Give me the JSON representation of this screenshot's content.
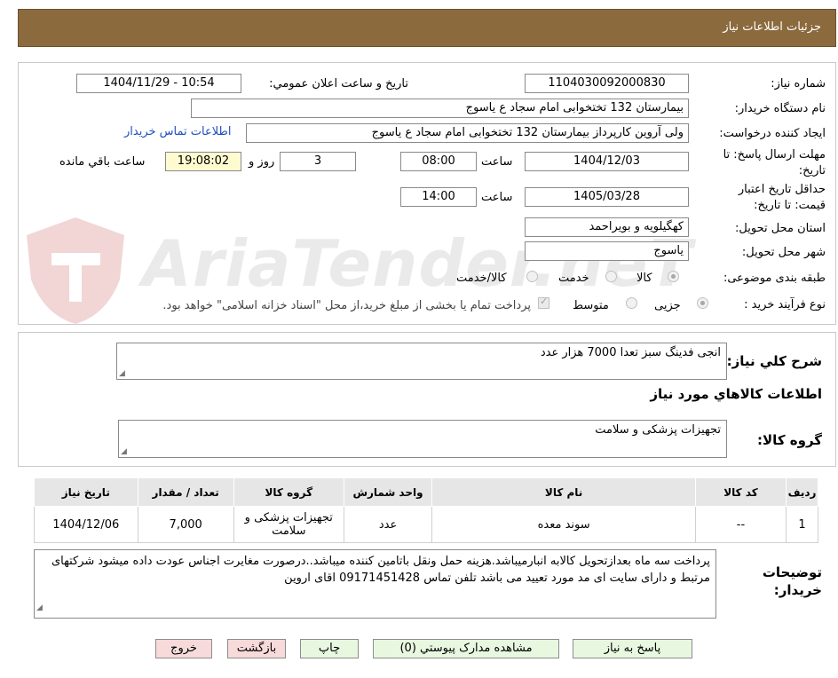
{
  "header": {
    "title": "جزئيات اطلاعات نياز"
  },
  "watermark": {
    "text": "AriaTender.neT"
  },
  "fields": {
    "need_number_label": "شماره نياز:",
    "need_number": "1104030092000830",
    "announce_label": "تاريخ و ساعت اعلان عمومي:",
    "announce_value": "1404/11/29 - 10:54",
    "buyer_org_label": "نام دستگاه خريدار:",
    "buyer_org": "بیمارستان 132 تختخوابی امام سجاد  ع  یاسوج",
    "requester_label": "ايجاد کننده درخواست:",
    "requester": "ولی آروین کارپرداز بیمارستان 132 تختخوابی امام سجاد  ع  یاسوج",
    "contact_link": "اطلاعات تماس خريدار",
    "deadline_label": "مهلت ارسال پاسخ: تا تاريخ:",
    "deadline_date": "1404/12/03",
    "time_label": "ساعت",
    "deadline_time": "08:00",
    "days_value": "3",
    "days_label": "روز و",
    "remaining_time": "19:08:02",
    "remaining_label": "ساعت باقي مانده",
    "price_validity_label": "حداقل تاريخ اعتبار قيمت: تا تاريخ:",
    "price_validity_date": "1405/03/28",
    "price_validity_time": "14:00",
    "province_label": "استان محل تحويل:",
    "province": "کهگیلویه و بویراحمد",
    "city_label": "شهر محل تحويل:",
    "city": "یاسوج",
    "category_label": "طبقه بندی موضوعی:",
    "category_options": [
      "کالا",
      "خدمت",
      "کالا/خدمت"
    ],
    "process_label": "نوع فرآيند خريد :",
    "process_options": [
      "جزیی",
      "متوسط"
    ],
    "payment_note": "پرداخت تمام يا بخشی از مبلغ خريد،از محل \"اسناد خزانه اسلامی\" خواهد بود."
  },
  "summary": {
    "label": "شرح کلي نياز:",
    "value": "انجی فدینگ  سبز تعدا 7000 هزار عدد",
    "items_heading": "اطلاعات کالاهاي مورد نياز",
    "group_label": "گروه کالا:",
    "group_value": "تجهیزات پزشکی و سلامت"
  },
  "table": {
    "headers": [
      "رديف",
      "کد کالا",
      "نام کالا",
      "واحد شمارش",
      "گروه کالا",
      "تعداد / مقدار",
      "تاريخ نياز"
    ],
    "rows": [
      [
        "1",
        "--",
        "سوند معده",
        "عدد",
        "تجهیزات پزشکی و سلامت",
        "7,000",
        "1404/12/06"
      ]
    ]
  },
  "notes": {
    "label": "توضيحات خريدار:",
    "value": "پرداخت سه ماه بعدازتحویل کالابه انبارمیباشد.هزینه حمل ونقل باتامین کننده میباشد..درصورت مغایرت اجناس عودت داده میشود شرکتهای مرتبط  و دارای سایت ای مد مورد تعیید می باشد  تلفن تماس 09171451428 اقای اروین"
  },
  "buttons": {
    "reply": "پاسخ به نياز",
    "attachments": "مشاهده مدارک پيوستي (0)",
    "print": "چاپ",
    "back": "بازگشت",
    "exit": "خروج"
  }
}
